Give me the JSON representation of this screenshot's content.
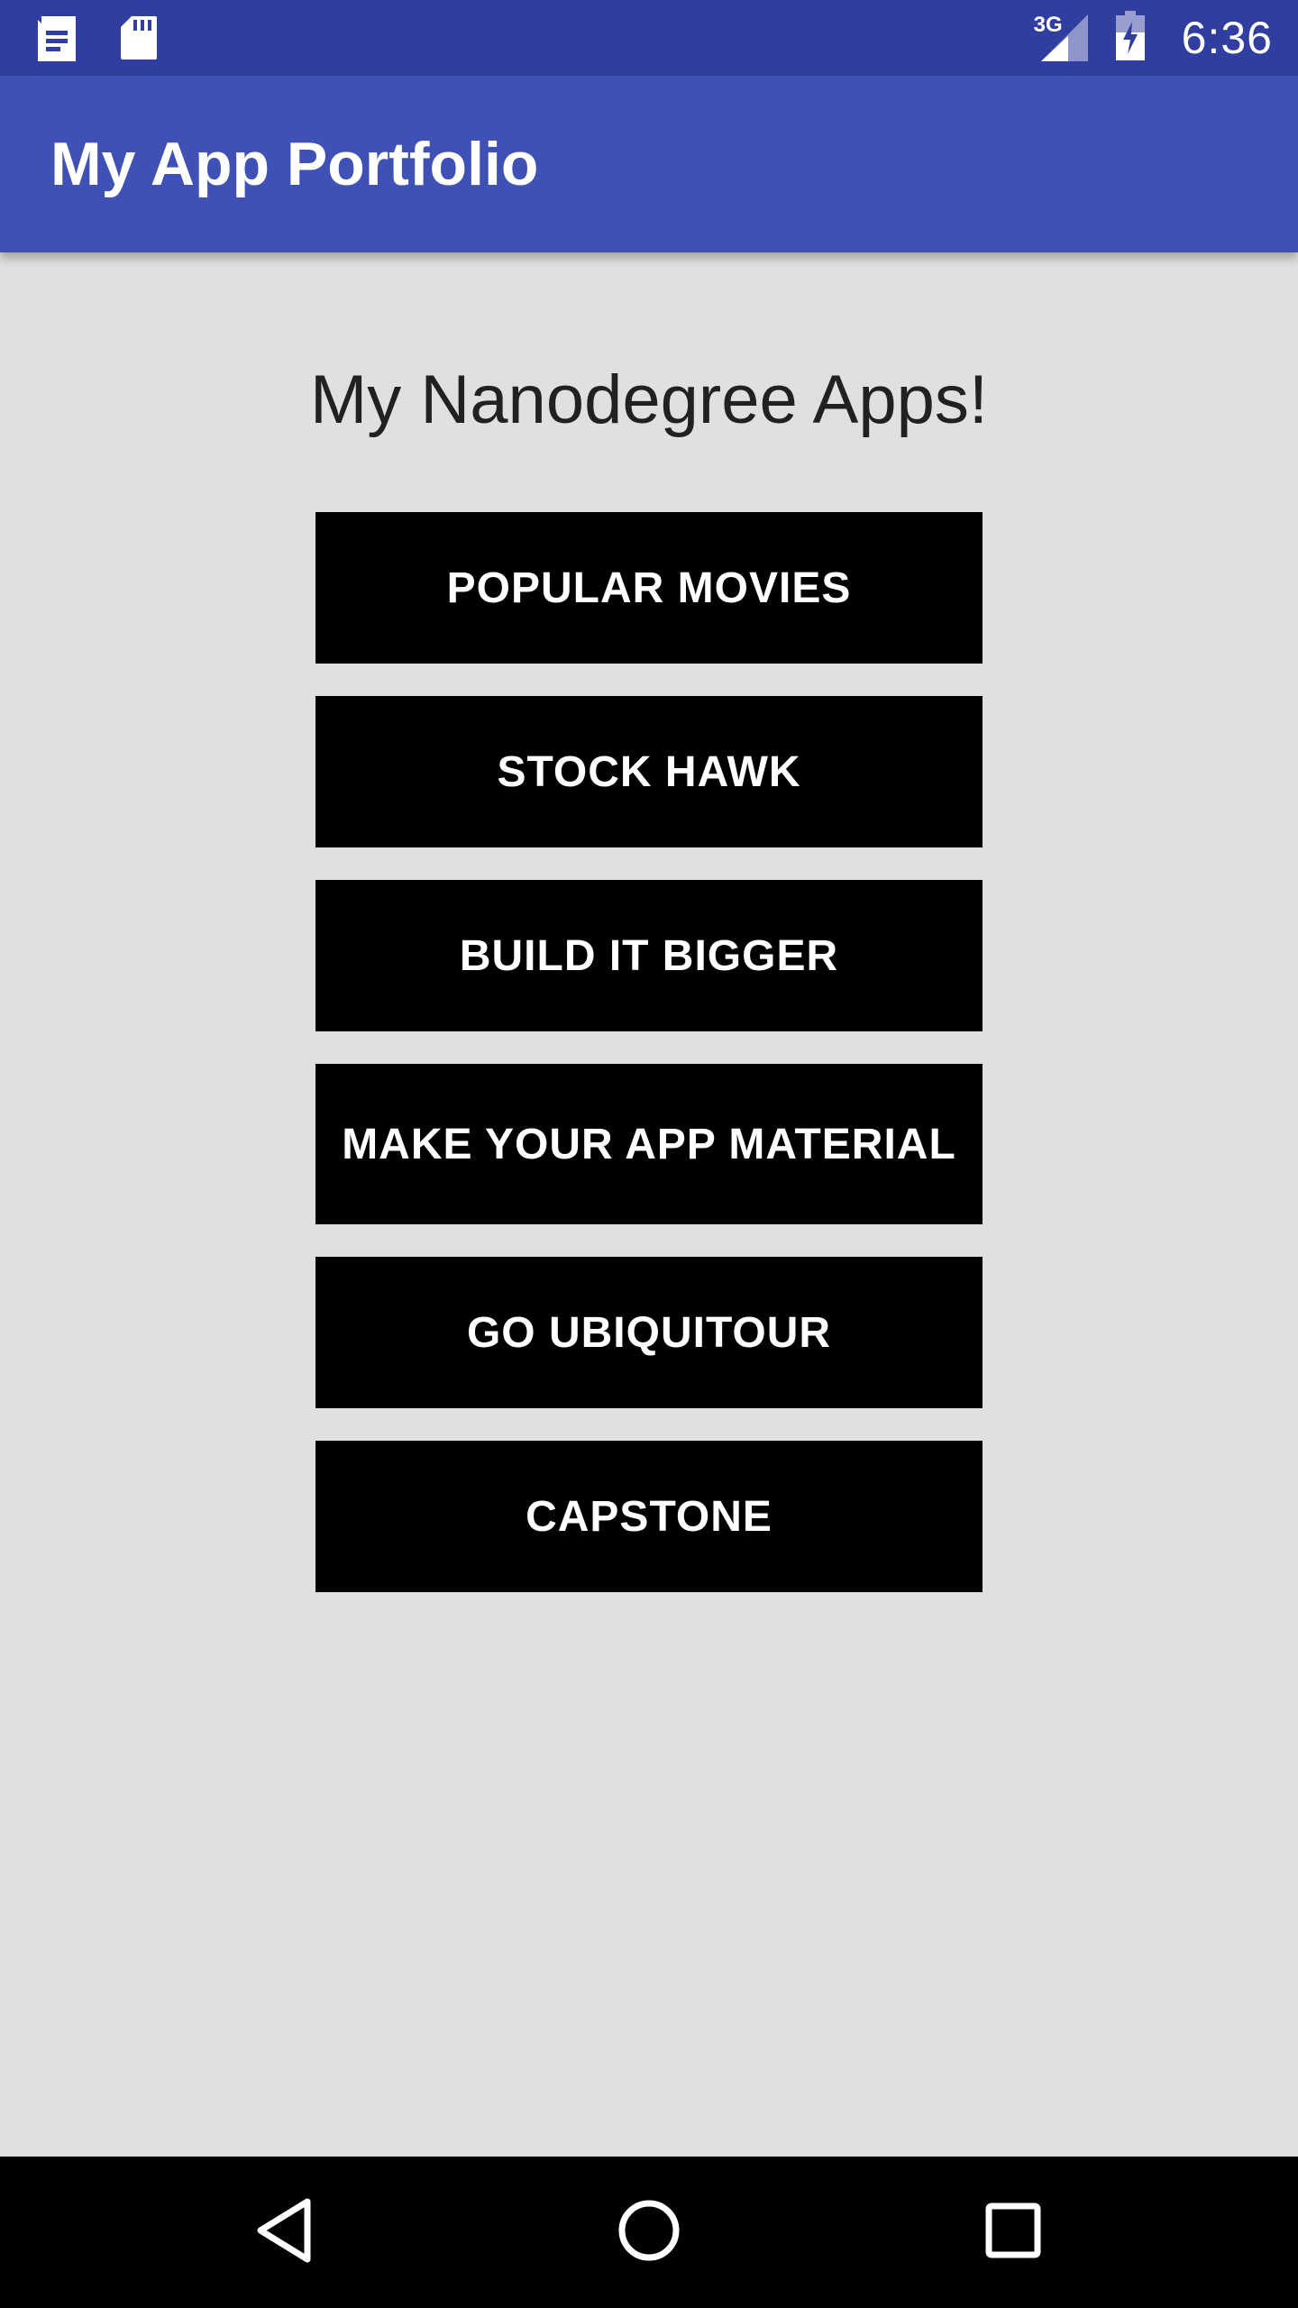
{
  "status_bar": {
    "left_icons": [
      "document-icon",
      "sd-card-icon"
    ],
    "network_label": "3G",
    "right_icons": [
      "signal-icon",
      "battery-charging-icon"
    ],
    "time": "6:36",
    "background": "#303f9f"
  },
  "app_bar": {
    "title": "My App Portfolio",
    "background": "#3f51b5"
  },
  "main": {
    "heading": "My Nanodegree Apps!",
    "buttons": [
      {
        "label": "POPULAR MOVIES"
      },
      {
        "label": "STOCK HAWK"
      },
      {
        "label": "BUILD IT BIGGER"
      },
      {
        "label": "MAKE YOUR APP MATERIAL"
      },
      {
        "label": "GO UBIQUITOUR"
      },
      {
        "label": "CAPSTONE"
      }
    ],
    "button_background": "#000000",
    "button_text_color": "#ffffff"
  },
  "nav_bar": {
    "icons": [
      "back-icon",
      "home-icon",
      "recents-icon"
    ]
  }
}
